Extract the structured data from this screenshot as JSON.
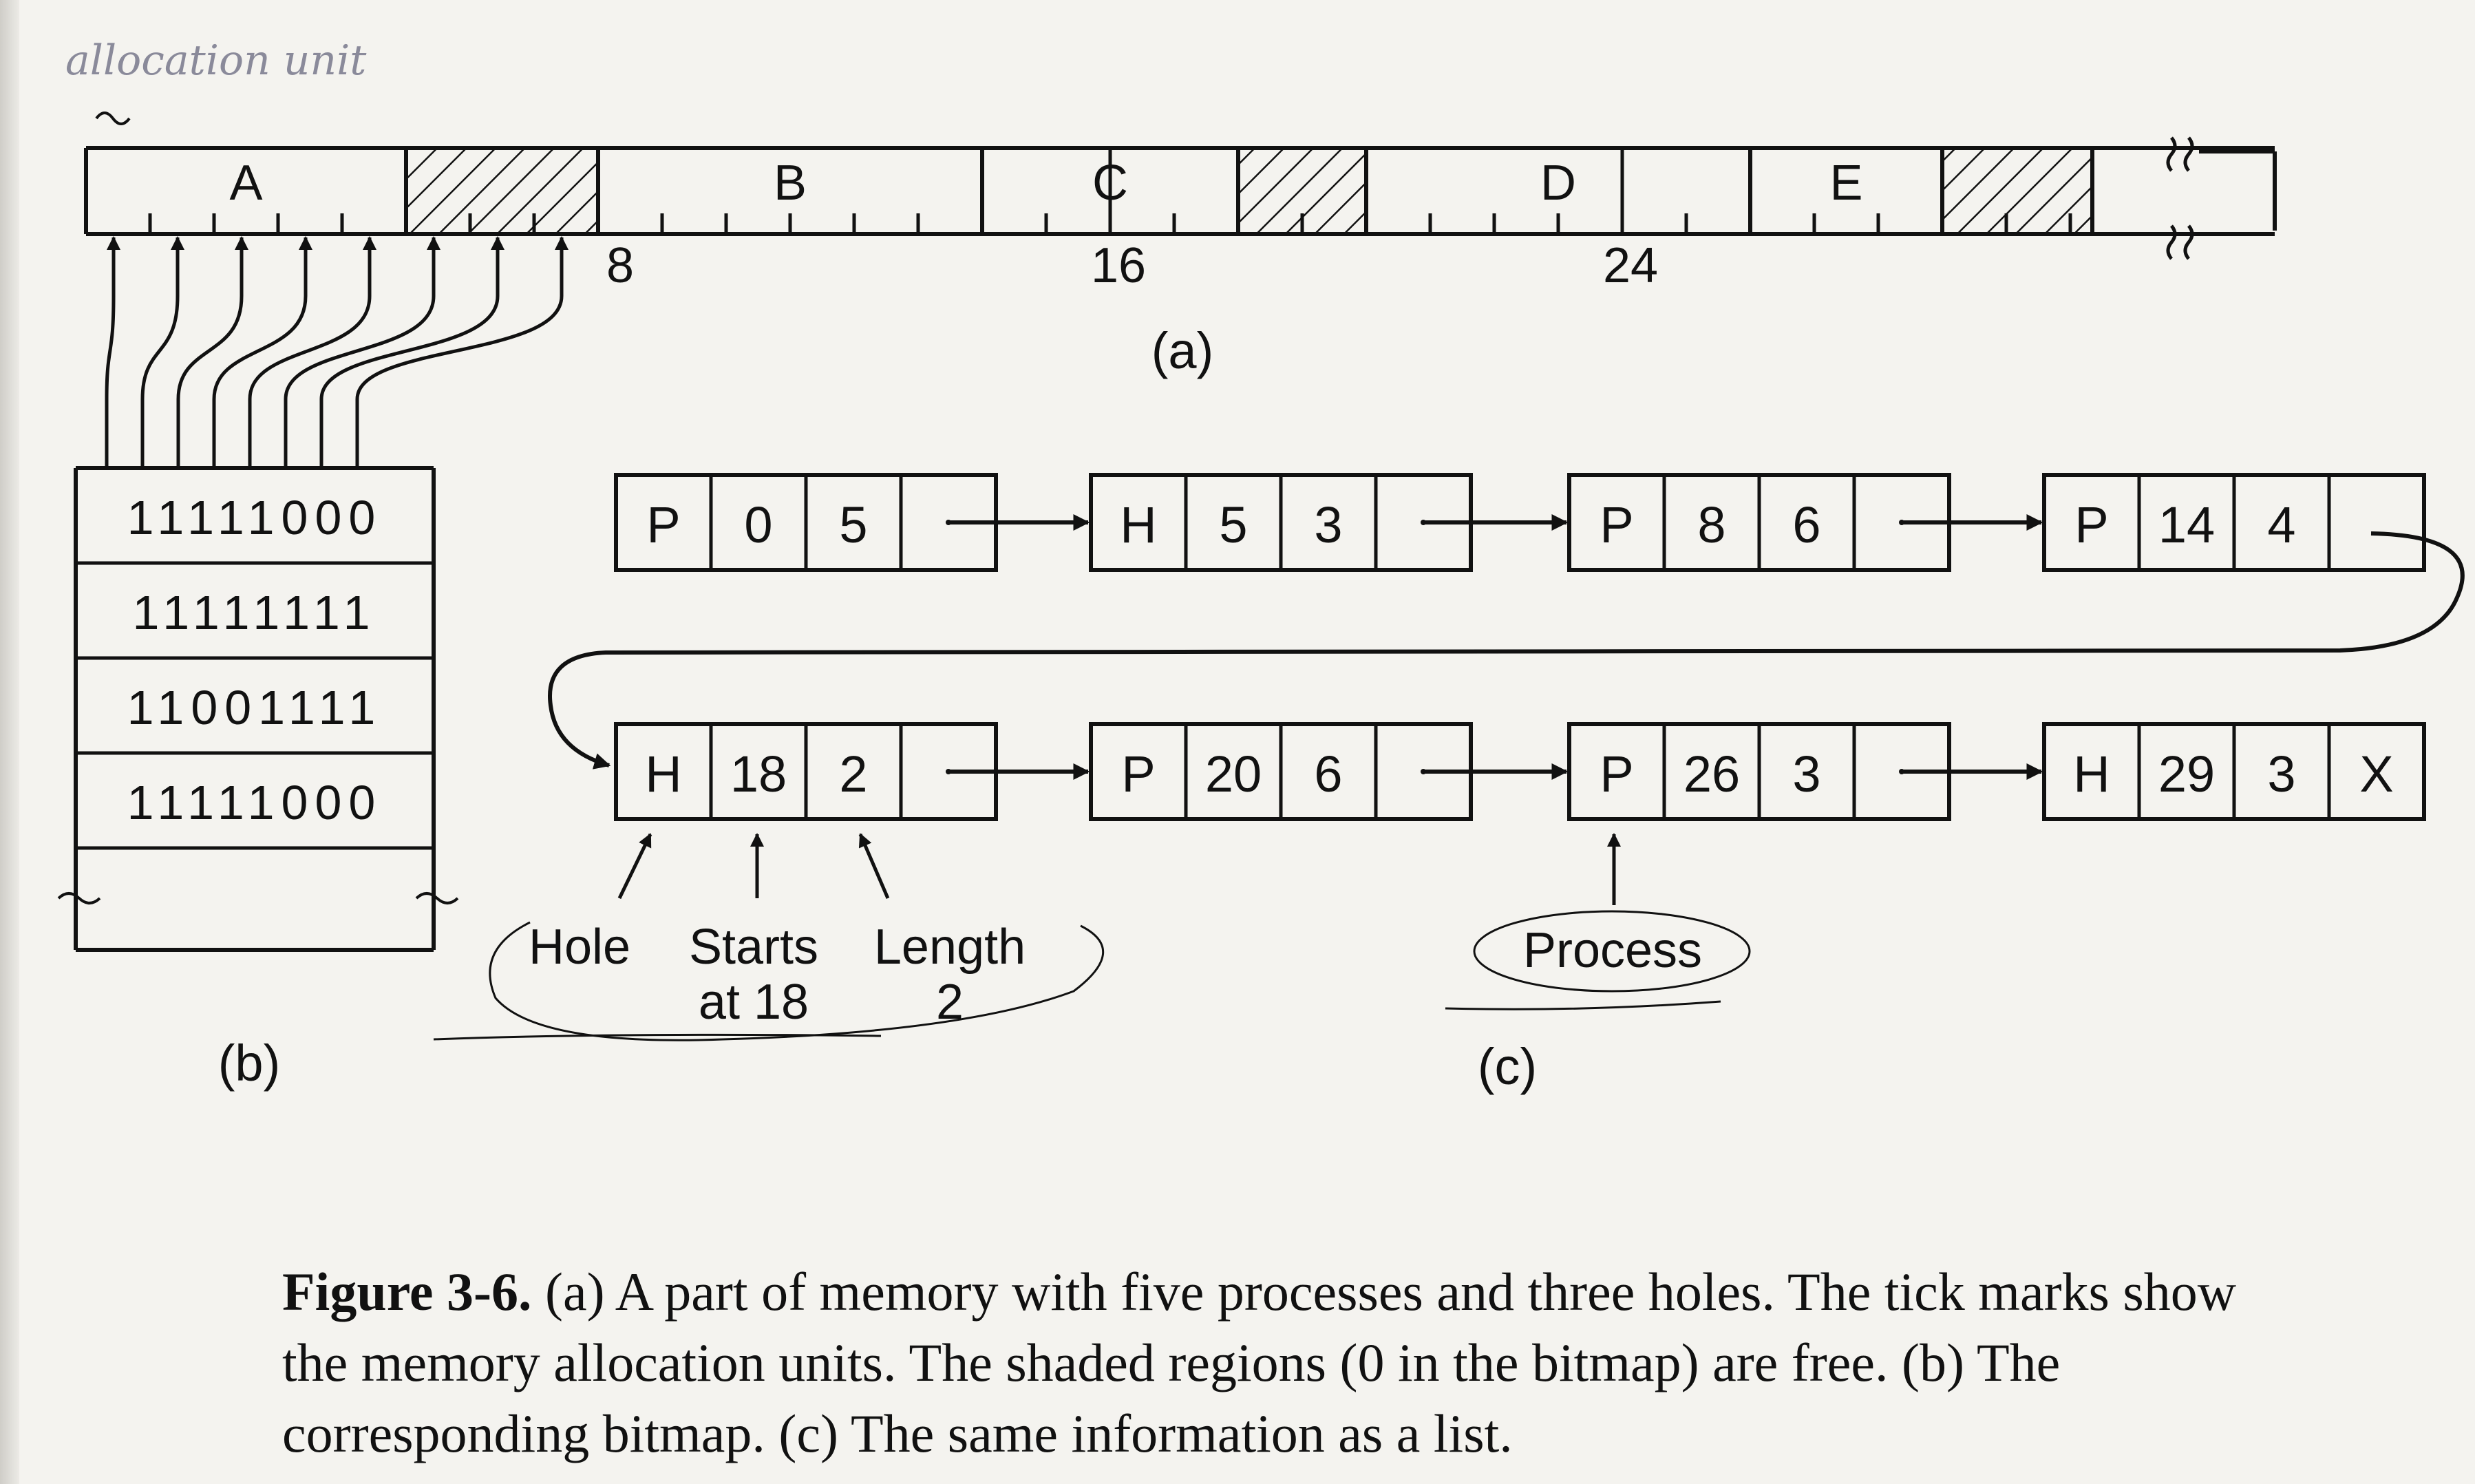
{
  "annotation_handwritten": "allocation unit",
  "memory_strip": {
    "units": 29,
    "segments": [
      {
        "type": "process",
        "label": "A",
        "start": 0,
        "length": 5
      },
      {
        "type": "hole",
        "label": "",
        "start": 5,
        "length": 3
      },
      {
        "type": "process",
        "label": "B",
        "start": 8,
        "length": 6
      },
      {
        "type": "process",
        "label": "C",
        "start": 14,
        "length": 4
      },
      {
        "type": "hole",
        "label": "",
        "start": 18,
        "length": 2
      },
      {
        "type": "process",
        "label": "D",
        "start": 20,
        "length": 6
      },
      {
        "type": "process",
        "label": "E",
        "start": 26,
        "length": 3
      },
      {
        "type": "hole",
        "label": "",
        "start": 29,
        "length": 3
      }
    ],
    "tick_numbers": [
      {
        "unit": 8,
        "label": "8"
      },
      {
        "unit": 16,
        "label": "16"
      },
      {
        "unit": 24,
        "label": "24"
      }
    ],
    "caption": "(a)"
  },
  "bitmap": {
    "rows": [
      "11111000",
      "11111111",
      "11001111",
      "11111000"
    ],
    "caption": "(b)"
  },
  "list": {
    "row1": [
      {
        "type": "P",
        "start": "0",
        "length": "5",
        "next": ""
      },
      {
        "type": "H",
        "start": "5",
        "length": "3",
        "next": ""
      },
      {
        "type": "P",
        "start": "8",
        "length": "6",
        "next": ""
      },
      {
        "type": "P",
        "start": "14",
        "length": "4",
        "next": ""
      }
    ],
    "row2": [
      {
        "type": "H",
        "start": "18",
        "length": "2",
        "next": ""
      },
      {
        "type": "P",
        "start": "20",
        "length": "6",
        "next": ""
      },
      {
        "type": "P",
        "start": "26",
        "length": "3",
        "next": ""
      },
      {
        "type": "H",
        "start": "29",
        "length": "3",
        "next": "X"
      }
    ],
    "labels": {
      "hole": "Hole",
      "starts_l1": "Starts",
      "starts_l2": "at 18",
      "length_l1": "Length",
      "length_l2": "2",
      "process": "Process"
    },
    "caption": "(c)"
  },
  "figure_caption": {
    "label": "Figure 3-6.",
    "text": " (a) A part of memory with five processes and three holes. The tick marks show the memory allocation units. The shaded regions (0 in the bitmap) are free.  (b) The corresponding bitmap.  (c) The same information as a list."
  }
}
